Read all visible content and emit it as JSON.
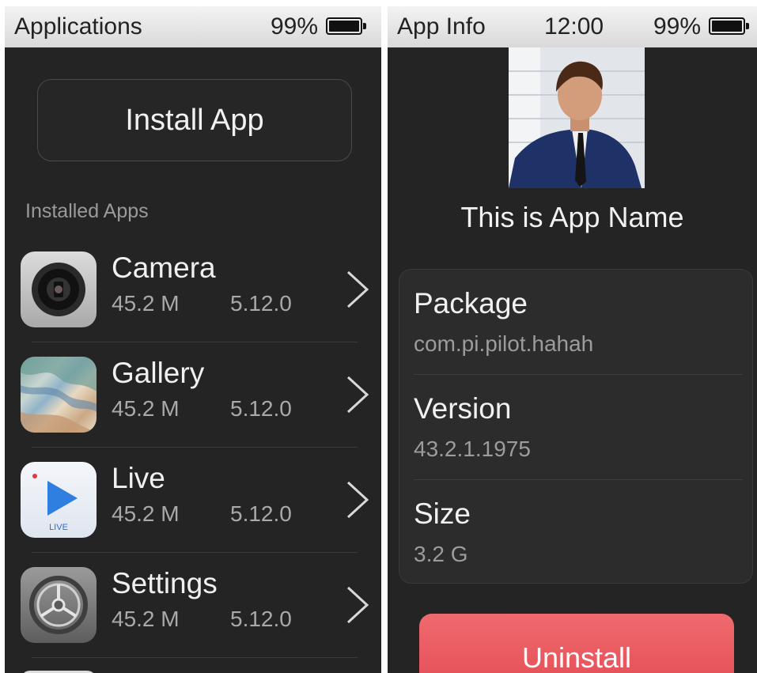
{
  "left_screen": {
    "status": {
      "title": "Applications",
      "battery_percent": "99%",
      "battery_icon": "battery-icon"
    },
    "install_button": "Install App",
    "section_label": "Installed Apps",
    "apps": [
      {
        "name": "Camera",
        "size": "45.2 M",
        "version": "5.12.0",
        "icon": "camera-app-icon"
      },
      {
        "name": "Gallery",
        "size": "45.2 M",
        "version": "5.12.0",
        "icon": "gallery-app-icon"
      },
      {
        "name": "Live",
        "size": "45.2 M",
        "version": "5.12.0",
        "icon": "live-app-icon",
        "icon_caption": "LIVE"
      },
      {
        "name": "Settings",
        "size": "45.2 M",
        "version": "5.12.0",
        "icon": "settings-app-icon"
      }
    ]
  },
  "right_screen": {
    "status": {
      "title": "App Info",
      "time": "12:00",
      "battery_percent": "99%",
      "battery_icon": "battery-icon"
    },
    "app_name": "This is App Name",
    "info": [
      {
        "label": "Package",
        "value": "com.pi.pilot.hahah"
      },
      {
        "label": "Version",
        "value": "43.2.1.1975"
      },
      {
        "label": "Size",
        "value": "3.2 G"
      }
    ],
    "uninstall_button": "Uninstall"
  },
  "colors": {
    "screen_bg": "#242424",
    "statusbar_bg": "#e6e6e6",
    "text_primary": "#f0f0f0",
    "text_secondary": "#a9a9a9",
    "danger": "#e8545b"
  }
}
